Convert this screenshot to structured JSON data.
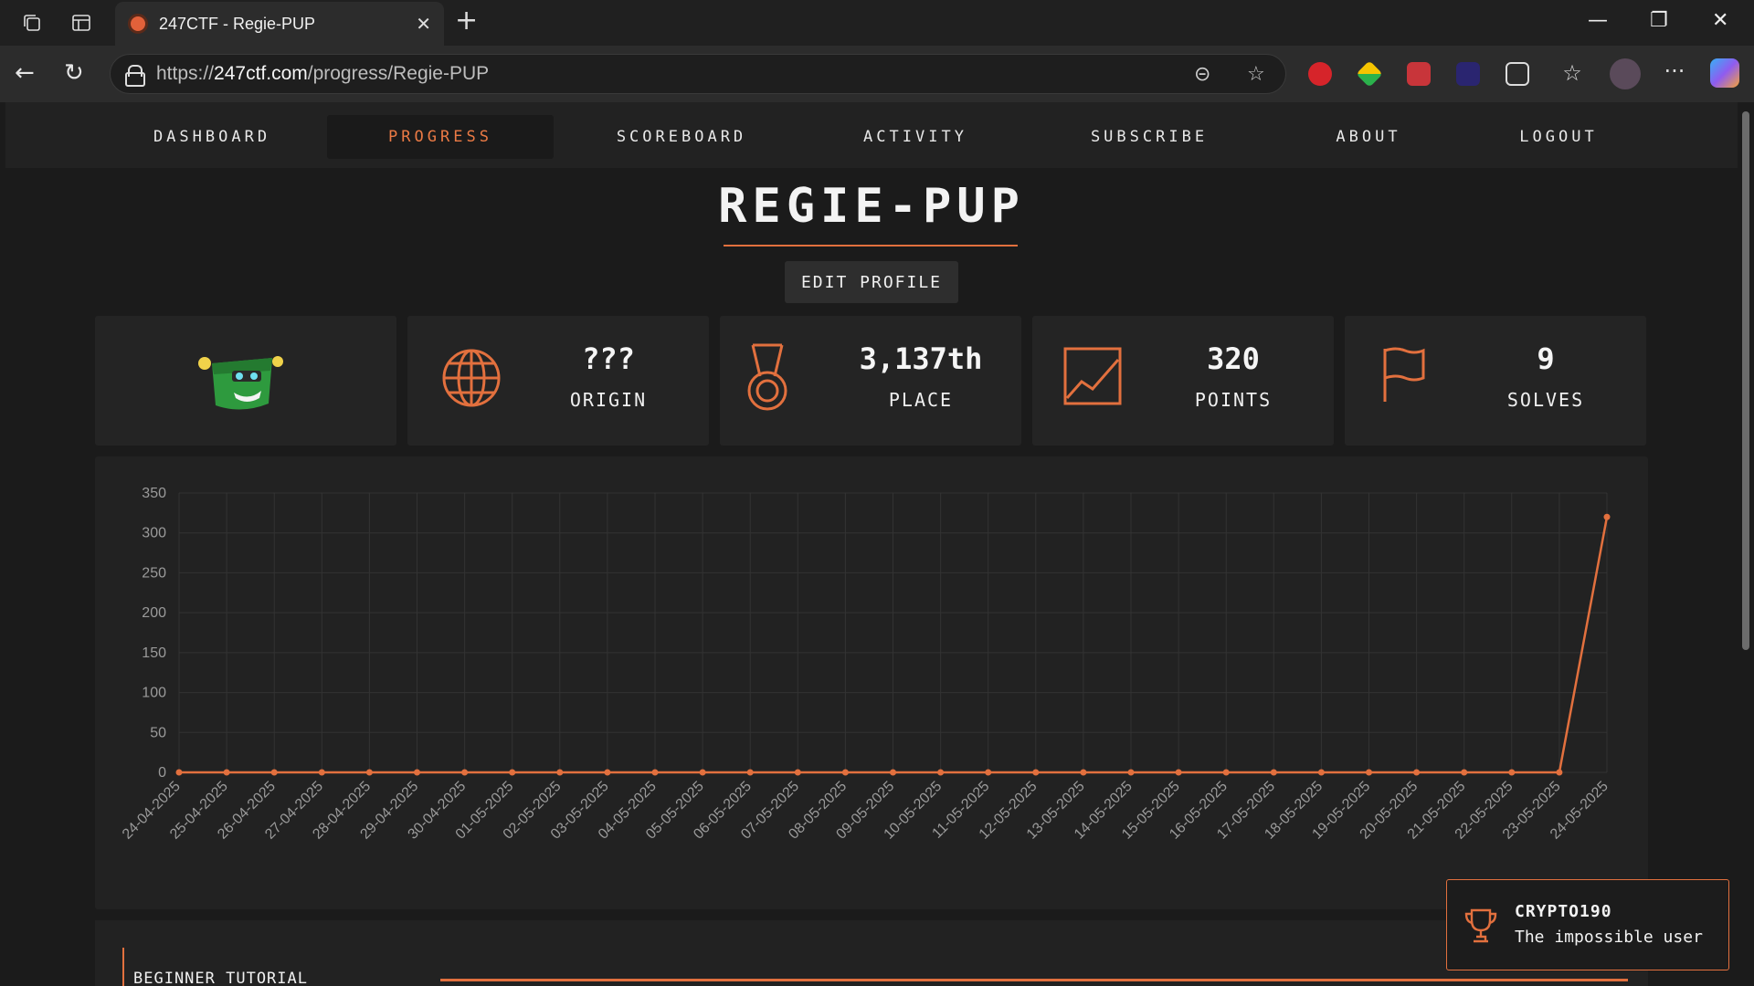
{
  "browser": {
    "tab_title": "247CTF - Regie-PUP",
    "url_prefix": "https://",
    "url_domain": "247ctf.com",
    "url_path": "/progress/Regie-PUP"
  },
  "nav": {
    "items": [
      {
        "label": "DASHBOARD"
      },
      {
        "label": "PROGRESS"
      },
      {
        "label": "SCOREBOARD"
      },
      {
        "label": "ACTIVITY"
      },
      {
        "label": "SUBSCRIBE"
      },
      {
        "label": "ABOUT"
      },
      {
        "label": "LOGOUT"
      }
    ],
    "active": "PROGRESS"
  },
  "profile": {
    "username": "REGIE-PUP",
    "edit_label": "EDIT PROFILE"
  },
  "stats": {
    "origin": {
      "value": "???",
      "label": "ORIGIN"
    },
    "place": {
      "value": "3,137th",
      "label": "PLACE"
    },
    "points": {
      "value": "320",
      "label": "POINTS"
    },
    "solves": {
      "value": "9",
      "label": "SOLVES"
    }
  },
  "colors": {
    "accent": "#e2703e",
    "background": "#1b1b1b",
    "card": "#242424"
  },
  "chart_data": {
    "type": "line",
    "x": [
      "24-04-2025",
      "25-04-2025",
      "26-04-2025",
      "27-04-2025",
      "28-04-2025",
      "29-04-2025",
      "30-04-2025",
      "01-05-2025",
      "02-05-2025",
      "03-05-2025",
      "04-05-2025",
      "05-05-2025",
      "06-05-2025",
      "07-05-2025",
      "08-05-2025",
      "09-05-2025",
      "10-05-2025",
      "11-05-2025",
      "12-05-2025",
      "13-05-2025",
      "14-05-2025",
      "15-05-2025",
      "16-05-2025",
      "17-05-2025",
      "18-05-2025",
      "19-05-2025",
      "20-05-2025",
      "21-05-2025",
      "22-05-2025",
      "23-05-2025",
      "24-05-2025"
    ],
    "series": [
      {
        "values": [
          0,
          0,
          0,
          0,
          0,
          0,
          0,
          0,
          0,
          0,
          0,
          0,
          0,
          0,
          0,
          0,
          0,
          0,
          0,
          0,
          0,
          0,
          0,
          0,
          0,
          0,
          0,
          0,
          0,
          0,
          320
        ]
      }
    ],
    "ylim": [
      0,
      350
    ],
    "yticks": [
      0,
      50,
      100,
      150,
      200,
      250,
      300,
      350
    ],
    "grid": true
  },
  "lower": {
    "section_title": "BEGINNER TUTORIAL"
  },
  "toast": {
    "title": "CRYPTO190",
    "subtitle": "The impossible user"
  }
}
